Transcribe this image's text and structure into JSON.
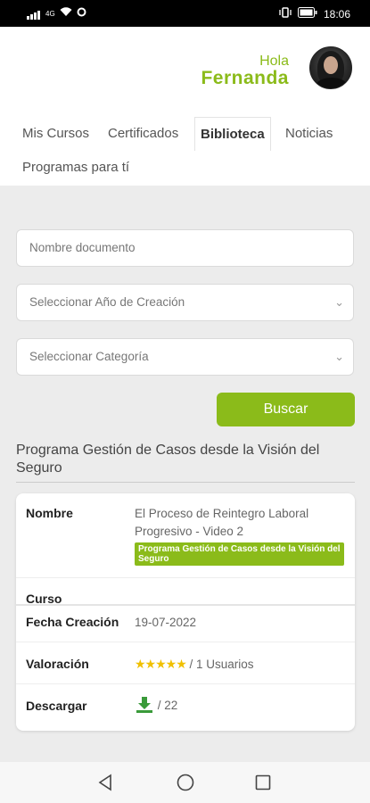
{
  "status_bar": {
    "time": "18:06",
    "network": "4G"
  },
  "header": {
    "greeting": "Hola",
    "user_name": "Fernanda"
  },
  "tabs": [
    {
      "label": "Mis Cursos"
    },
    {
      "label": "Certificados"
    },
    {
      "label": "Biblioteca",
      "active": true
    },
    {
      "label": "Noticias"
    },
    {
      "label": "Programas para tí"
    }
  ],
  "filters": {
    "document_name_placeholder": "Nombre documento",
    "year_select": "Seleccionar Año de Creación",
    "category_select": "Seleccionar Categoría",
    "search_button": "Buscar"
  },
  "section_title": "Programa Gestión de Casos desde la Visión del Seguro",
  "document": {
    "nombre_label": "Nombre",
    "nombre_value": "El Proceso de Reintegro Laboral Progresivo - Video 2",
    "program_badge": "Programa Gestión de Casos desde la Visión del Seguro",
    "curso_label": "Curso",
    "fecha_label": "Fecha Creación",
    "fecha_value": "19-07-2022",
    "valoracion_label": "Valoración",
    "rating_stars": 5,
    "rating_users": "/ 1 Usuarios",
    "descargar_label": "Descargar",
    "downloads": "/ 22"
  },
  "colors": {
    "accent": "#8bbb1a",
    "background": "#ececec"
  },
  "icons": [
    "signal-icon",
    "wifi-icon",
    "vibrate-icon",
    "battery-icon",
    "chevron-down-icon",
    "star-icon",
    "download-icon",
    "back-icon",
    "home-icon",
    "recents-icon"
  ]
}
